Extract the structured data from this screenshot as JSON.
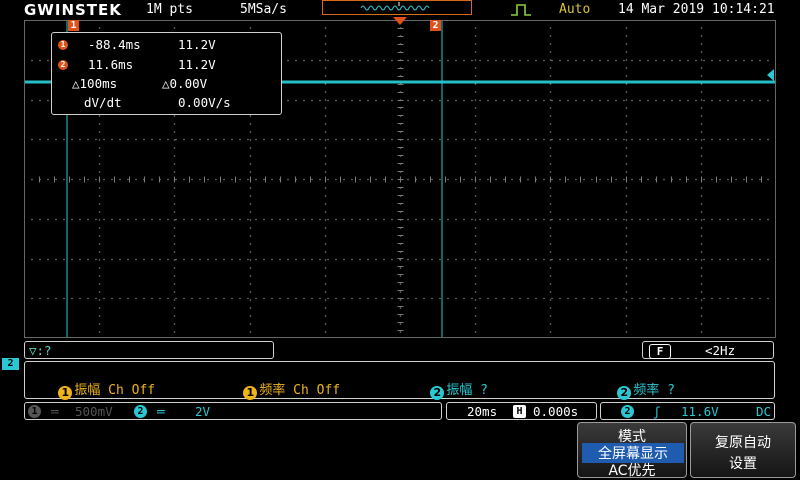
{
  "header": {
    "brand": "GWINSTEK",
    "record_length": "1M pts",
    "sample_rate": "5MSa/s",
    "run_status": "Auto",
    "date": "14 Mar 2019",
    "time": "10:14:21",
    "trigger_icon": "trigger-edge-icon"
  },
  "cursors": {
    "marker1": "1",
    "marker2": "2",
    "row1": {
      "badge": "1",
      "time": "-88.4ms",
      "volt": "11.2V"
    },
    "row2": {
      "badge": "2",
      "time": "11.6ms",
      "volt": "11.2V"
    },
    "delta_time": "△100ms",
    "delta_volt": "△0.00V",
    "dvdt_label": "dV/dt",
    "dvdt_value": "0.00V/s"
  },
  "channel2_marker": "2",
  "math_bar": {
    "text": "▽:?"
  },
  "filter_bar": {
    "badge": "F",
    "text": "<2Hz"
  },
  "measurements": [
    {
      "badge": "1",
      "label": "振幅",
      "value": "Ch Off"
    },
    {
      "badge": "1",
      "label": "频率",
      "value": "Ch Off"
    },
    {
      "badge": "2",
      "label": "振幅",
      "value": "?"
    },
    {
      "badge": "2",
      "label": "频率",
      "value": "?"
    }
  ],
  "channel_bar": {
    "ch1_badge": "1",
    "ch1_coupling": "═",
    "ch1_scale": "500mV",
    "ch2_badge": "2",
    "ch2_coupling": "═",
    "ch2_scale": "2V"
  },
  "timebase": {
    "scale": "20ms",
    "pos_badge": "H",
    "position": "0.000s"
  },
  "trigger": {
    "badge": "2",
    "slope": "ʃ",
    "level": "11.6V",
    "coupling": "DC"
  },
  "softkeys": {
    "mode_title": "模式",
    "mode_option1": "全屏幕显示",
    "mode_option2": "AC优先",
    "reset_line1": "复原自动",
    "reset_line2": "设置"
  },
  "colors": {
    "ch2": "#2ac8d2",
    "ch1": "#f0b41a",
    "cursor_marker": "#e0521a",
    "auto": "#d8c23a"
  }
}
